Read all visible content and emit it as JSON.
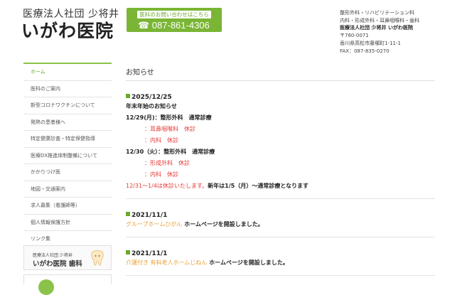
{
  "header": {
    "logo_sub": "医療法人社団 少将井",
    "logo_main": "いがわ医院",
    "contact_label": "医科のお問い合わせはこちら",
    "phone": "☎ 087-861-4306",
    "info_lines": [
      "整形外科・リハビリテーション科",
      "内科・形成外科・耳鼻咽喉科・歯科",
      "医療法人社団 少将井 いがわ医院",
      "〒760-0071",
      "香川県高松市藤塚町1-11-1",
      "FAX：087-835-0270"
    ]
  },
  "sidebar": {
    "items": [
      {
        "label": "ホーム"
      },
      {
        "label": "医科のご案内"
      },
      {
        "label": "新型コロナワクチンについて"
      },
      {
        "label": "発熱の患者様へ"
      },
      {
        "label": "特定健康診査・特定保健指導"
      },
      {
        "label": "医療DX推進体制整備について"
      },
      {
        "label": "かかりつけ医"
      },
      {
        "label": "地図・交通案内"
      },
      {
        "label": "求人募集（看護師等）"
      },
      {
        "label": "個人情報保護方針"
      },
      {
        "label": "リンク集"
      }
    ],
    "banner_sub": "医療法人社団 少将井",
    "banner_main": "いがわ医院 歯科"
  },
  "main": {
    "title": "お知らせ",
    "news1": {
      "date": "2025/12/25",
      "heading": "年末年始のお知らせ",
      "day1": "12/29(月)：整形外科　通常診療",
      "day1_items": [
        "：耳鼻咽喉科　休診",
        "：内科　休診"
      ],
      "day2": "12/30（火）：整形外科　通常診療",
      "day2_items": [
        "：形成外科　休診",
        "：内科　休診"
      ],
      "closing_red": "12/31～1/4は休診いたします。",
      "closing_black": "新年は1/5（月）～通常診療となります"
    },
    "news2": {
      "date": "2021/11/1",
      "link": "グループホームひがん",
      "text": " ホームページを開設しました。"
    },
    "news3": {
      "date": "2021/11/1",
      "link": "介護付き 有料老人ホームじねん",
      "text": " ホームページを開設しました。"
    }
  }
}
